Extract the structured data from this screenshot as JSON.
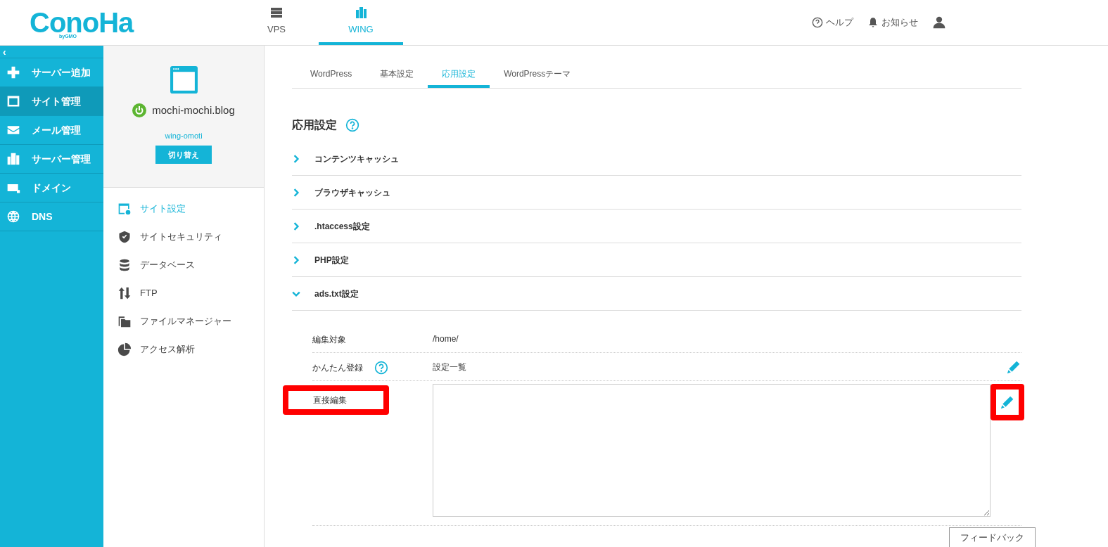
{
  "logo": {
    "main": "ConoHa",
    "sub": "byGMO"
  },
  "top_nav": [
    {
      "label": "VPS",
      "selected": false
    },
    {
      "label": "WING",
      "selected": true
    }
  ],
  "header_links": [
    {
      "kind": "help",
      "label": "ヘルプ"
    },
    {
      "kind": "bell",
      "label": "お知らせ"
    },
    {
      "kind": "user"
    }
  ],
  "collapse_button": "‹",
  "sidebar": [
    {
      "kind": "plus",
      "label": "サーバー追加",
      "selected": false
    },
    {
      "kind": "window",
      "label": "サイト管理",
      "selected": true
    },
    {
      "kind": "mail",
      "label": "メール管理",
      "selected": false
    },
    {
      "kind": "server",
      "label": "サーバー管理",
      "selected": false
    },
    {
      "kind": "domain",
      "label": "ドメイン",
      "selected": false
    },
    {
      "kind": "globe",
      "label": "DNS",
      "selected": false
    }
  ],
  "site": {
    "domain": "mochi-mochi.blog",
    "account": "wing-omoti",
    "switch_button": "切り替え"
  },
  "site_menu": [
    {
      "kind": "settings",
      "label": "サイト設定",
      "selected": true
    },
    {
      "kind": "shield",
      "label": "サイトセキュリティ",
      "selected": false
    },
    {
      "kind": "database",
      "label": "データベース",
      "selected": false
    },
    {
      "kind": "transfer",
      "label": "FTP",
      "selected": false
    },
    {
      "kind": "folder",
      "label": "ファイルマネージャー",
      "selected": false
    },
    {
      "kind": "pie",
      "label": "アクセス解析",
      "selected": false
    }
  ],
  "tabs": [
    {
      "label": "WordPress",
      "selected": false
    },
    {
      "label": "基本設定",
      "selected": false
    },
    {
      "label": "応用設定",
      "selected": true
    },
    {
      "label": "WordPressテーマ",
      "selected": false
    }
  ],
  "section_title": "応用設定",
  "accordion": [
    {
      "label": "コンテンツキャッシュ",
      "expanded": false
    },
    {
      "label": "ブラウザキャッシュ",
      "expanded": false
    },
    {
      "label": ".htaccess設定",
      "expanded": false
    },
    {
      "label": "PHP設定",
      "expanded": false
    },
    {
      "label": "ads.txt設定",
      "expanded": true,
      "rows": [
        {
          "kind": "text",
          "label": "編集対象",
          "value": "/home/",
          "help": false,
          "highlighted": false
        },
        {
          "kind": "editable",
          "label": "かんたん登録",
          "value": "設定一覧",
          "help": true,
          "highlighted": false
        },
        {
          "kind": "textarea",
          "label": "直接編集",
          "value": "",
          "help": false,
          "highlighted": true
        }
      ]
    }
  ],
  "feedback_button": "フィードバック"
}
